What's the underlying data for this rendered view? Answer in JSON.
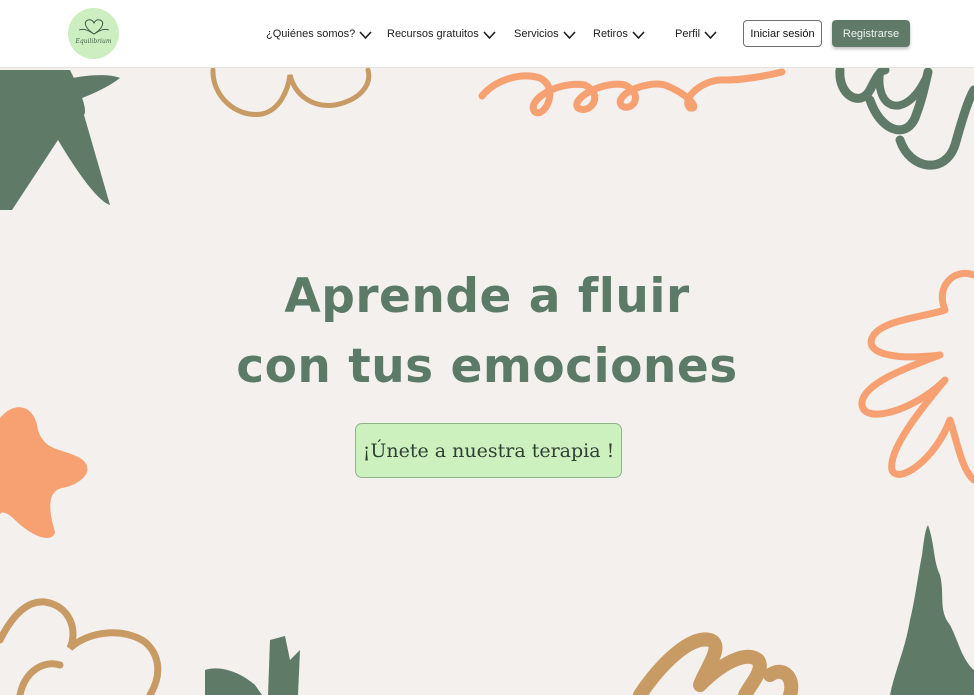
{
  "nav": {
    "logo_text": "Equilibrium",
    "items": [
      {
        "label": "¿Quiénes somos?"
      },
      {
        "label": "Recursos gratuitos"
      },
      {
        "label": "Servicios"
      },
      {
        "label": "Retiros"
      },
      {
        "label": "Perfil"
      }
    ],
    "login_label": "Iniciar sesión",
    "register_label": "Registrarse"
  },
  "hero": {
    "title_line1": "Aprende a fluir",
    "title_line2": "con tus emociones",
    "cta_label": "¡Únete a nuestra terapia !"
  },
  "colors": {
    "sage": "#5f7b68",
    "orange": "#f7a071",
    "tan": "#c79b63",
    "mint": "#cdf0bf",
    "background": "#f3f0ed"
  }
}
